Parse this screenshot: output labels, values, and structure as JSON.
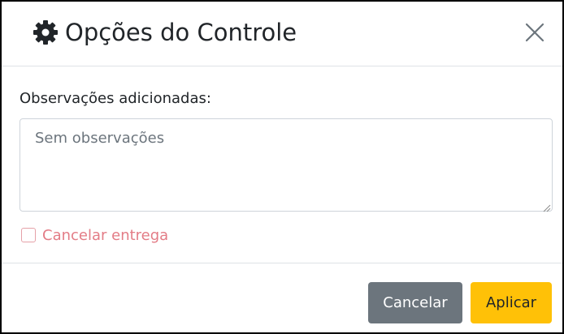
{
  "dialog": {
    "title": "Opções do Controle",
    "title_icon": "gear-icon",
    "close_icon": "close-icon"
  },
  "observations": {
    "label": "Observações adicionadas:",
    "value": "",
    "placeholder": "Sem observações"
  },
  "cancel_delivery": {
    "label": "Cancelar entrega",
    "checked": false
  },
  "footer": {
    "cancel_label": "Cancelar",
    "apply_label": "Aplicar"
  },
  "colors": {
    "cancel_button": "#6c757d",
    "apply_button": "#ffc107",
    "checkbox_label": "#e37c86"
  }
}
